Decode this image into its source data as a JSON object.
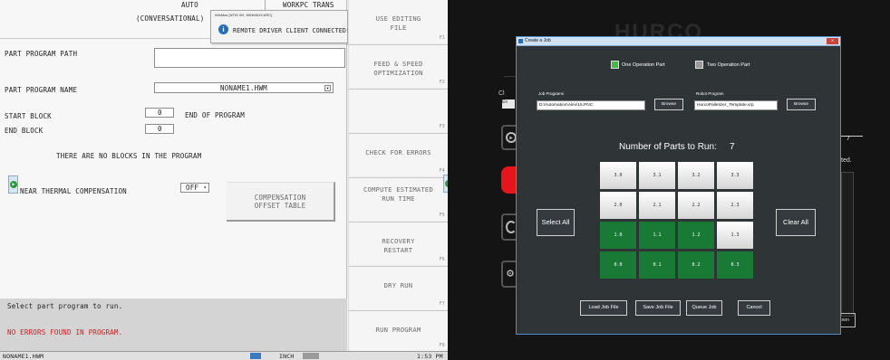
{
  "control": {
    "top": {
      "mode1": "AUTO",
      "mode2": "(CONVERSATIONAL)",
      "right": "WORKPC TRANS"
    },
    "fields": {
      "path_label": "PART PROGRAM PATH",
      "name_label": "PART PROGRAM NAME",
      "name_value": "NONAME1.HWM",
      "start_label": "START BLOCK",
      "start_value": "0",
      "end_label": "END BLOCK",
      "end_value": "0",
      "end_of_program": "END OF PROGRAM",
      "no_blocks": "THERE ARE NO BLOCKS IN THE PROGRAM",
      "thermal_label": "NEAR THERMAL COMPENSATION",
      "thermal_value": "OFF",
      "comp_line1": "COMPENSATION",
      "comp_line2": "OFFSET TABLE"
    },
    "messages": {
      "prompt": "Select part program to run.",
      "errors": "NO ERRORS FOUND IN PROGRAM."
    },
    "notification": {
      "title": "WinMax [NTID 5H, WINMAXCARC]",
      "text": "REMOTE DRIVER CLIENT CONNECTED!"
    },
    "softkeys": [
      {
        "label": "USE EDITING FILE",
        "num": "F1"
      },
      {
        "label": "FEED & SPEED OPTIMIZATION",
        "num": "F2"
      },
      {
        "label": "",
        "num": "F3"
      },
      {
        "label": "CHECK FOR ERRORS",
        "num": "F4"
      },
      {
        "label": "COMPUTE ESTIMATED RUN TIME",
        "num": "F5"
      },
      {
        "label": "RECOVERY RESTART",
        "num": "F6"
      },
      {
        "label": "DRY RUN",
        "num": "F7"
      },
      {
        "label": "RUN PROGRAM",
        "num": "F8"
      }
    ],
    "status": {
      "file": "NONAME1.HWM",
      "units": "INCH",
      "time": "1:53 PM"
    }
  },
  "behind": {
    "logo": "HURCO",
    "ch_stub": "Cl",
    "en_stub": "En",
    "num_stub": "7",
    "ted_stub": "ted.",
    "own_stub": "own"
  },
  "dialog": {
    "title": "Create a Job",
    "one_op_label": "One Operation Part",
    "two_op_label": "Two Operation Part",
    "job_programs_label": "Job Programs",
    "job_programs_value": "D:\\Automation\\Alex\\15.PNC",
    "browse_label": "Browse",
    "robot_program_label": "Robot Program",
    "robot_program_value": "HurcoPalletizer_Template.xrp",
    "parts_label": "Number of Parts to Run:",
    "parts_value": "7",
    "select_all_label": "Select All",
    "clear_all_label": "Clear All",
    "grid": [
      [
        {
          "label": "3.0",
          "selected": false
        },
        {
          "label": "3.1",
          "selected": false
        },
        {
          "label": "3.2",
          "selected": false
        },
        {
          "label": "3.3",
          "selected": false
        }
      ],
      [
        {
          "label": "2.0",
          "selected": false
        },
        {
          "label": "2.1",
          "selected": false
        },
        {
          "label": "2.2",
          "selected": false
        },
        {
          "label": "2.3",
          "selected": false
        }
      ],
      [
        {
          "label": "1.0",
          "selected": true
        },
        {
          "label": "1.1",
          "selected": true
        },
        {
          "label": "1.2",
          "selected": true
        },
        {
          "label": "1.3",
          "selected": false
        }
      ],
      [
        {
          "label": "0.0",
          "selected": true
        },
        {
          "label": "0.1",
          "selected": true
        },
        {
          "label": "0.2",
          "selected": true
        },
        {
          "label": "0.3",
          "selected": true
        }
      ]
    ],
    "buttons": {
      "load": "Load Job File",
      "save": "Save Job File",
      "queue": "Queue Job",
      "cancel": "Cancel"
    }
  },
  "colors": {
    "selected_tile": "#197a36",
    "one_op_swatch": "#3fbf3f",
    "two_op_swatch": "#9a9a9a",
    "error_text": "#d02020",
    "stop_red": "#e8141c"
  }
}
